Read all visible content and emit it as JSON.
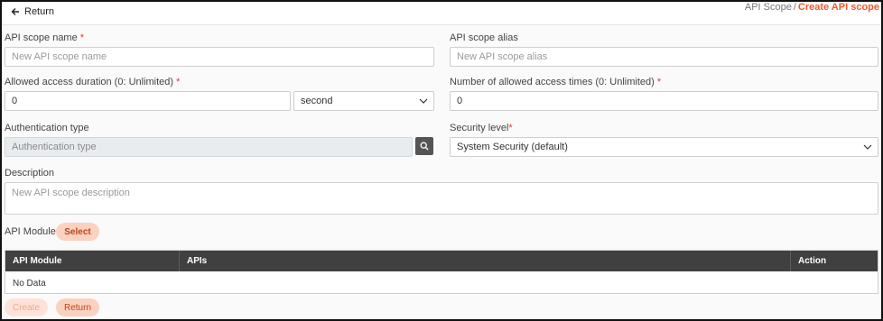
{
  "header": {
    "return_label": "Return",
    "breadcrumb_parent": "API Scope",
    "breadcrumb_separator": "/",
    "breadcrumb_current": "Create API scope"
  },
  "form": {
    "scope_name": {
      "label": "API scope name",
      "required_mark": "*",
      "placeholder": "New API scope name",
      "value": ""
    },
    "scope_alias": {
      "label": "API scope alias",
      "placeholder": "New API scope alias",
      "value": ""
    },
    "access_duration": {
      "label": "Allowed access duration (0: Unlimited)",
      "required_mark": "*",
      "value": "0",
      "unit_value": "second"
    },
    "access_times": {
      "label": "Number of allowed access times (0: Unlimited)",
      "required_mark": "*",
      "value": "0"
    },
    "auth_type": {
      "label": "Authentication type",
      "placeholder": "Authentication type"
    },
    "security_level": {
      "label": "Security level",
      "required_mark": "*",
      "value": "System Security (default)"
    },
    "description": {
      "label": "Description",
      "placeholder": "New API scope description"
    }
  },
  "module": {
    "label": "API Module",
    "select_label": "Select"
  },
  "table": {
    "columns": [
      "API Module",
      "APIs",
      "Action"
    ],
    "empty_text": "No Data"
  },
  "footer": {
    "create_label": "Create",
    "return_label": "Return"
  },
  "colors": {
    "accent": "#f15a2b",
    "pill_bg": "#fbd2c0",
    "table_header_bg": "#404040"
  }
}
